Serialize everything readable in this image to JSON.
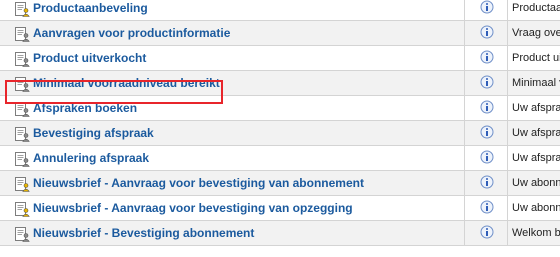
{
  "colors": {
    "link": "#1b5a9e",
    "highlight": "#e8252b",
    "info_icon": "#3b6fc4"
  },
  "icons": {
    "row_icon": "document-person-icon",
    "info": "info-icon"
  },
  "rows": [
    {
      "name": "Productaanbeveling",
      "description": "Productaa",
      "highlighted": false,
      "active": true
    },
    {
      "name": "Aanvragen voor productinformatie",
      "description": "Vraag ove",
      "highlighted": false,
      "active": false
    },
    {
      "name": "Product uitverkocht",
      "description": "Product uit",
      "highlighted": false,
      "active": false
    },
    {
      "name": "Minimaal voorraadniveau bereikt",
      "description": "Minimaal v",
      "highlighted": true,
      "active": false
    },
    {
      "name": "Afspraken boeken",
      "description": "Uw afspra",
      "highlighted": false,
      "active": false
    },
    {
      "name": "Bevestiging afspraak",
      "description": "Uw afspra",
      "highlighted": false,
      "active": false
    },
    {
      "name": "Annulering afspraak",
      "description": "Uw afspra",
      "highlighted": false,
      "active": false
    },
    {
      "name": "Nieuwsbrief - Aanvraag voor bevestiging van abonnement",
      "description": "Uw abonn",
      "highlighted": false,
      "active": true
    },
    {
      "name": "Nieuwsbrief - Aanvraag voor bevestiging van opzegging",
      "description": "Uw abonn",
      "highlighted": false,
      "active": true
    },
    {
      "name": "Nieuwsbrief - Bevestiging abonnement",
      "description": "Welkom bi",
      "highlighted": false,
      "active": false
    }
  ]
}
